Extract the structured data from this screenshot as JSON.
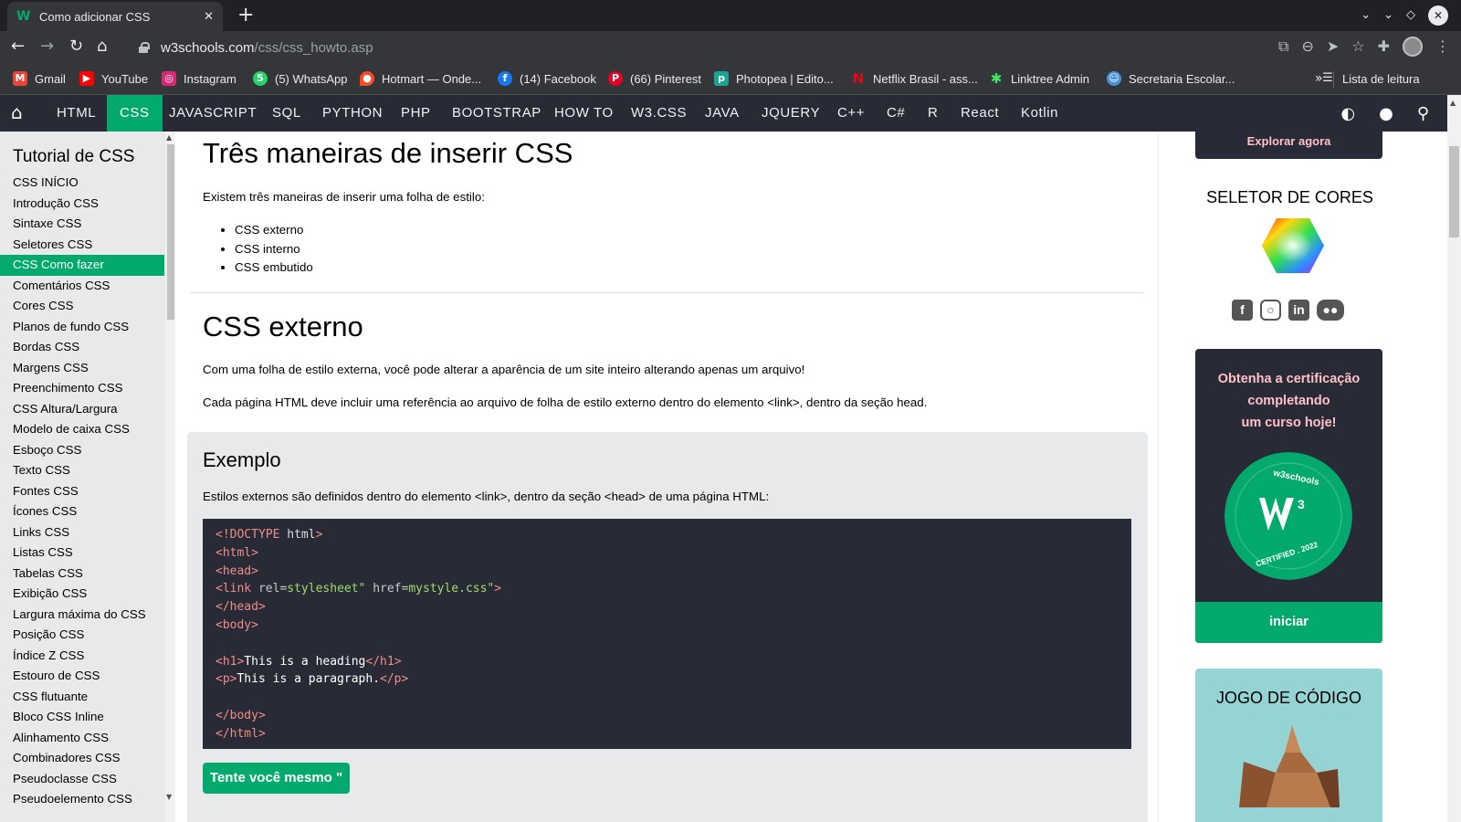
{
  "browser": {
    "tab_title": "Como adicionar CSS",
    "url_host": "w3schools.com",
    "url_path": "/css/css_howto.asp",
    "reading_list": "Lista de leitura"
  },
  "bookmarks": [
    {
      "label": "Gmail",
      "icon": "gmail-icon",
      "color": "#ea4335"
    },
    {
      "label": "YouTube",
      "icon": "youtube-icon",
      "color": "#ff0000"
    },
    {
      "label": "Instagram",
      "icon": "instagram-icon",
      "color": "#d62976"
    },
    {
      "label": "(5) WhatsApp",
      "icon": "whatsapp-icon",
      "color": "#25d366"
    },
    {
      "label": "Hotmart — Onde...",
      "icon": "hotmart-icon",
      "color": "#f04e23"
    },
    {
      "label": "(14) Facebook",
      "icon": "facebook-icon",
      "color": "#1877f2"
    },
    {
      "label": "(66) Pinterest",
      "icon": "pinterest-icon",
      "color": "#e60023"
    },
    {
      "label": "Photopea | Edito...",
      "icon": "photopea-icon",
      "color": "#18a497"
    },
    {
      "label": "Netflix Brasil - ass...",
      "icon": "netflix-icon",
      "color": "#e50914"
    },
    {
      "label": "Linktree Admin",
      "icon": "linktree-icon",
      "color": "#43e660"
    },
    {
      "label": "Secretaria Escolar...",
      "icon": "secretaria-icon",
      "color": "#4a90d9"
    }
  ],
  "w3nav": {
    "items": [
      "HTML",
      "CSS",
      "JAVASCRIPT",
      "SQL",
      "PYTHON",
      "PHP",
      "BOOTSTRAP",
      "HOW TO",
      "W3.CSS",
      "JAVA",
      "JQUERY",
      "C++",
      "C#",
      "R",
      "React",
      "Kotlin"
    ],
    "active": "CSS",
    "accent": "#04aa6d"
  },
  "sidebar": {
    "title": "Tutorial de CSS",
    "items": [
      "CSS INÍCIO",
      "Introdução CSS",
      "Sintaxe CSS",
      "Seletores CSS",
      "CSS Como fazer",
      "Comentários CSS",
      "Cores CSS",
      "Planos de fundo CSS",
      "Bordas CSS",
      "Margens CSS",
      "Preenchimento CSS",
      "CSS Altura/Largura",
      "Modelo de caixa CSS",
      "Esboço CSS",
      "Texto CSS",
      "Fontes CSS",
      "Ícones CSS",
      "Links CSS",
      "Listas CSS",
      "Tabelas CSS",
      "Exibição CSS",
      "Largura máxima do CSS",
      "Posição CSS",
      "Índice Z CSS",
      "Estouro de CSS",
      "CSS flutuante",
      "Bloco CSS Inline",
      "Alinhamento CSS",
      "Combinadores CSS",
      "Pseudoclasse CSS",
      "Pseudoelemento CSS"
    ],
    "active": "CSS Como fazer"
  },
  "main": {
    "heading": "Três maneiras de inserir CSS",
    "intro": "Existem três maneiras de inserir uma folha de estilo:",
    "ways": [
      "CSS externo",
      "CSS interno",
      "CSS embutido"
    ],
    "ext_heading": "CSS externo",
    "ext_p1": "Com uma folha de estilo externa, você pode alterar a aparência de um site inteiro alterando apenas um arquivo!",
    "ext_p2": "Cada página HTML deve incluir uma referência ao arquivo de folha de estilo externo dentro do elemento <link>, dentro da seção head.",
    "example": {
      "title": "Exemplo",
      "desc": "Estilos externos são definidos dentro do elemento <link>, dentro da seção <head> de uma página HTML:",
      "code_lines": [
        "<!DOCTYPE html>",
        "<html>",
        "<head>",
        "<link rel=\"stylesheet\" href=\"mystyle.css\">",
        "</head>",
        "<body>",
        "",
        "<h1>This is a heading</h1>",
        "<p>This is a paragraph.</p>",
        "",
        "</body>",
        "</html>"
      ],
      "try_button": "Tente você mesmo \""
    }
  },
  "right": {
    "explore": "Explorar agora",
    "color_picker_title": "SELETOR DE CORES",
    "cert_text": [
      "Obtenha a certificação",
      "completando",
      "um curso hoje!"
    ],
    "badge_top": "w3schools",
    "badge_bottom": "CERTIFIED . 2022",
    "start_button": "iniciar",
    "game_title": "JOGO DE CÓDIGO"
  }
}
